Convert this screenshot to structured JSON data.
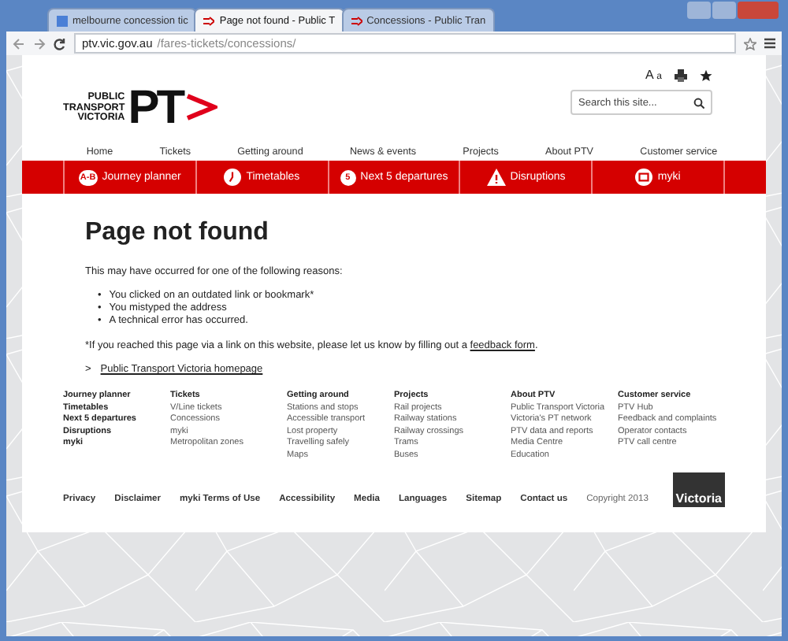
{
  "browser": {
    "tabs": [
      {
        "label": "melbourne concession tic",
        "selected": false
      },
      {
        "label": "Page not found - Public T",
        "selected": true
      },
      {
        "label": "Concessions - Public Tran",
        "selected": false
      }
    ],
    "url_host": "ptv.vic.gov.au",
    "url_path": "/fares-tickets/concessions/"
  },
  "header": {
    "logo_lines": [
      "PUBLIC",
      "TRANSPORT",
      "VICTORIA"
    ],
    "logo_mark": "PT",
    "text_size": [
      "A",
      "a"
    ],
    "search_placeholder": "Search this site..."
  },
  "nav": [
    "Home",
    "Tickets",
    "Getting around",
    "News & events",
    "Projects",
    "About PTV",
    "Customer service"
  ],
  "quick_links": [
    {
      "label": "Journey planner",
      "badge": "A-B"
    },
    {
      "label": "Timetables"
    },
    {
      "label": "Next 5 departures",
      "badge": "5"
    },
    {
      "label": "Disruptions"
    },
    {
      "label": "myki"
    }
  ],
  "content": {
    "title": "Page not found",
    "intro": "This may have occurred for one of the following reasons:",
    "bullet": "•",
    "reasons": [
      "You clicked on an outdated link or bookmark*",
      "You mistyped the address",
      "A technical error has occurred."
    ],
    "note": "*If you reached this page via a link on this website, please let us know by filling out a",
    "note_link": "feedback form",
    "note_end": ".",
    "home_arrow": ">",
    "home_link": "Public Transport Victoria homepage"
  },
  "footer_columns": [
    {
      "kind": "bold",
      "items": [
        "Journey planner",
        "Timetables",
        "Next 5 departures",
        "Disruptions",
        "myki"
      ]
    },
    {
      "kind": "section",
      "heading": "Tickets",
      "items": [
        "V/Line tickets",
        "Concessions",
        "myki",
        "Metropolitan zones"
      ]
    },
    {
      "kind": "section",
      "heading": "Getting around",
      "items": [
        "Stations and stops",
        "Accessible transport",
        "Lost property",
        "Travelling safely",
        "Maps"
      ]
    },
    {
      "kind": "section",
      "heading": "Projects",
      "items": [
        "Rail projects",
        "Railway stations",
        "Railway crossings",
        "Trams",
        "Buses"
      ]
    },
    {
      "kind": "section",
      "heading": "About PTV",
      "items": [
        "Public Transport Victoria",
        "Victoria's PT network",
        "PTV data and reports",
        "Media Centre",
        "Education"
      ]
    },
    {
      "kind": "section",
      "heading": "Customer service",
      "items": [
        "PTV Hub",
        "Feedback and complaints",
        "Operator contacts",
        "PTV call centre"
      ]
    }
  ],
  "footer_links": [
    "Privacy",
    "Disclaimer",
    "myki Terms of Use",
    "Accessibility",
    "Media",
    "Languages",
    "Sitemap",
    "Contact us"
  ],
  "copyright": "Copyright 2013",
  "state_logo": "Victoria"
}
